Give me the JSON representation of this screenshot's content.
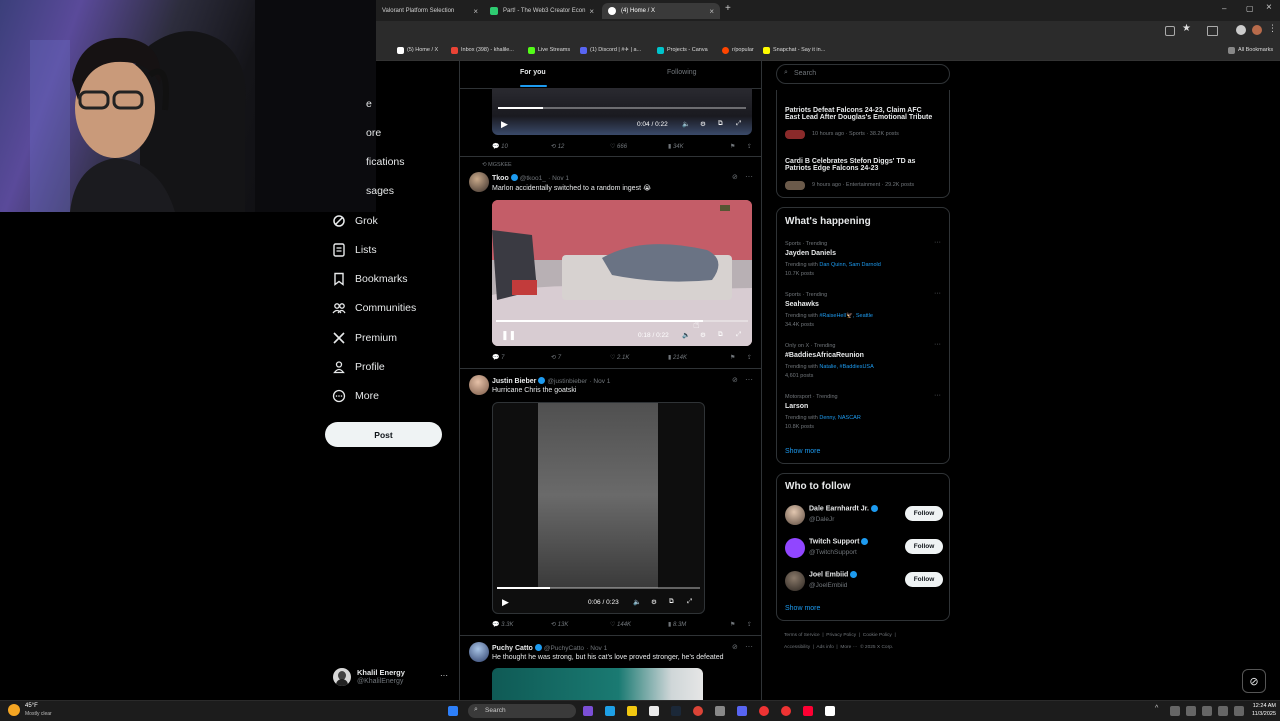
{
  "browser": {
    "tabs": [
      {
        "label": "Valorant Platform Selection",
        "color": "#ff4655"
      },
      {
        "label": "Part! - The Web3 Creator Econ",
        "color": "#2ecc71"
      },
      {
        "label": "(4) Home / X",
        "color": "#ffffff"
      }
    ],
    "new_tab": "+",
    "window_controls": {
      "minimize": "–",
      "maximize": "▢",
      "close": "×"
    },
    "bookmarks": [
      {
        "label": "(5) Home / X",
        "color": "#ffffff"
      },
      {
        "label": "Inbox (398) - khalile...",
        "color": "#ea4335"
      },
      {
        "label": "Live Streams",
        "color": "#53fc18"
      },
      {
        "label": "(1) Discord | #✈ | a...",
        "color": "#5865f2"
      },
      {
        "label": "Projects - Canva",
        "color": "#00c4cc"
      },
      {
        "label": "r/popular",
        "color": "#ff4500"
      },
      {
        "label": "Snapchat - Say it in...",
        "color": "#fffc00"
      }
    ],
    "all_bookmarks": "All Bookmarks"
  },
  "sidebar": {
    "items": [
      {
        "label": "e",
        "icon": "home-icon"
      },
      {
        "label": "ore",
        "icon": "explore-icon"
      },
      {
        "label": "fications",
        "icon": "bell-icon"
      },
      {
        "label": "sages",
        "icon": "mail-icon"
      },
      {
        "label": "Grok",
        "icon": "grok-icon"
      },
      {
        "label": "Lists",
        "icon": "list-icon"
      },
      {
        "label": "Bookmarks",
        "icon": "bookmark-icon"
      },
      {
        "label": "Communities",
        "icon": "communities-icon"
      },
      {
        "label": "Premium",
        "icon": "x-logo-icon"
      },
      {
        "label": "Profile",
        "icon": "profile-icon"
      },
      {
        "label": "More",
        "icon": "more-icon"
      }
    ],
    "post_label": "Post",
    "account": {
      "name": "Khalil Energy",
      "handle": "@KhalilEnergy",
      "menu": "···"
    }
  },
  "feed": {
    "tabs": [
      {
        "label": "For you"
      },
      {
        "label": "Following"
      }
    ],
    "tweets": [
      {
        "video": {
          "time": "0:04 / 0:22",
          "progress": 0.18
        },
        "stats": {
          "replies": "10",
          "reposts": "12",
          "likes": "666",
          "views": "34K"
        }
      },
      {
        "context": "MGSKEE",
        "name": "Tkoo",
        "handle": "@tkoo1_",
        "date": "· Nov 1",
        "text": "Marlon accidentally switched to a random ingest 😭",
        "video": {
          "time": "0:18 / 0:22",
          "progress": 0.82
        },
        "stats": {
          "replies": "7",
          "reposts": "7",
          "likes": "2.1K",
          "views": "214K"
        }
      },
      {
        "name": "Justin Bieber",
        "handle": "@justinbieber",
        "date": "· Nov 1",
        "text": "Hurricane Chris the goatski",
        "video": {
          "time": "0:06 / 0:23",
          "progress": 0.26
        },
        "stats": {
          "replies": "3.3K",
          "reposts": "13K",
          "likes": "144K",
          "views": "8.3M"
        }
      },
      {
        "name": "Puchy Catto",
        "handle": "@PuchyCatto",
        "date": "· Nov 1",
        "text": "He thought he was strong, but his cat's love proved stronger, he's defeated"
      }
    ]
  },
  "right": {
    "search_placeholder": "Search",
    "news": [
      {
        "title_line1": "Patriots Defeat Falcons 24-23, Claim AFC",
        "title_line2": "East Lead After Douglas's Emotional Tribute",
        "meta": "10 hours ago · Sports · 38.2K posts"
      },
      {
        "title_line1": "Cardi B Celebrates Stefon Diggs' TD as",
        "title_line2": "Patriots Edge Falcons 24-23",
        "meta": "9 hours ago · Entertainment · 29.2K posts"
      }
    ],
    "happening": {
      "title": "What's happening",
      "trends": [
        {
          "meta": "Sports · Trending",
          "name": "Jayden Daniels",
          "with_prefix": "Trending with",
          "with": "Dan Quinn, Sam Darnold",
          "posts": "10.7K posts"
        },
        {
          "meta": "Sports · Trending",
          "name": "Seahawks",
          "with_prefix": "Trending with",
          "with": "#RaiseHell🦅, Seattle",
          "posts": "34.4K posts"
        },
        {
          "meta": "Only on X · Trending",
          "name": "#BaddiesAfricaReunion",
          "with_prefix": "Trending with",
          "with": "Natalie, #BaddiesUSA",
          "posts": "4,601 posts"
        },
        {
          "meta": "Motorsport · Trending",
          "name": "Larson",
          "with_prefix": "Trending with",
          "with": "Denny, NASCAR",
          "posts": "10.8K posts"
        }
      ],
      "show_more": "Show more"
    },
    "who_to_follow": {
      "title": "Who to follow",
      "people": [
        {
          "name": "Dale Earnhardt Jr.",
          "handle": "@DaleJr",
          "button": "Follow"
        },
        {
          "name": "Twitch Support",
          "handle": "@TwitchSupport",
          "button": "Follow"
        },
        {
          "name": "Joel Embiid",
          "handle": "@JoelEmbiid",
          "button": "Follow"
        }
      ],
      "show_more": "Show more"
    },
    "footer": {
      "line1": "Terms of Service  |  Privacy Policy  |  Cookie Policy  |",
      "line2": "Accessibility  |  Ads info  |  More ···  © 2025 X Corp."
    }
  },
  "taskbar": {
    "weather_temp": "45°F",
    "weather_desc": "Mostly clear",
    "search_placeholder": "Search",
    "time": "12:24 AM",
    "date": "11/3/2025"
  }
}
